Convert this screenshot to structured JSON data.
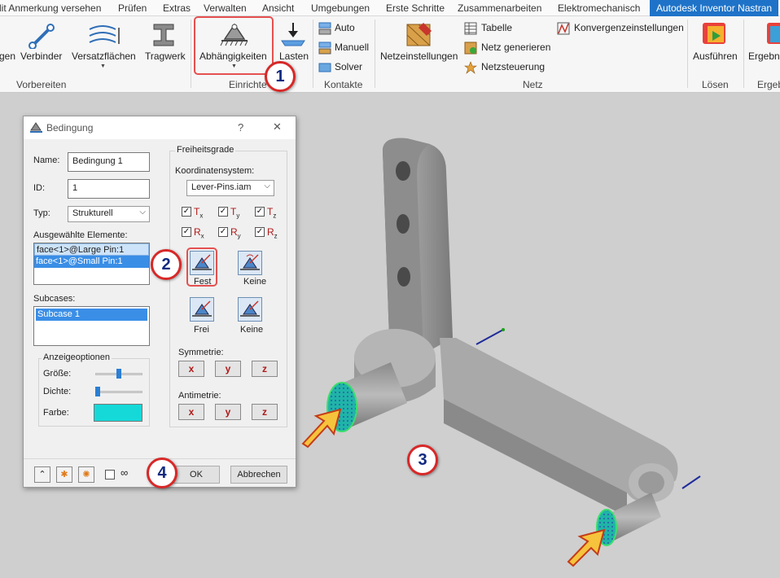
{
  "tabs": [
    "lit Anmerkung versehen",
    "Prüfen",
    "Extras",
    "Verwalten",
    "Ansicht",
    "Umgebungen",
    "Erste Schritte",
    "Zusammenarbeiten",
    "Elektromechanisch",
    "Autodesk Inventor Nastran"
  ],
  "ribbon": {
    "btn_gen": "gen",
    "btn_verbinder": "Verbinder",
    "btn_versatz": "Versatzflächen",
    "btn_tragwerk": "Tragwerk",
    "btn_abhaengig": "Abhängigkeiten",
    "btn_lasten": "Lasten",
    "btn_auto": "Auto",
    "btn_manuell": "Manuell",
    "btn_solver": "Solver",
    "btn_netzeinst": "Netzeinstellungen",
    "btn_tabelle": "Tabelle",
    "btn_netzgen": "Netz generieren",
    "btn_netzsteu": "Netzsteuerung",
    "btn_konvergenz": "Konvergenzeinstellungen",
    "btn_ausfuehren": "Ausführen",
    "btn_ergebnis": "Ergebnis",
    "grp_vorbereiten": "Vorbereiten",
    "grp_einrichten": "Einrichte",
    "grp_kontakte": "Kontakte",
    "grp_netz": "Netz",
    "grp_loesen": "Lösen",
    "grp_ergeb": "Ergeb"
  },
  "dialog": {
    "title": "Bedingung",
    "help": "?",
    "close": "✕",
    "name_label": "Name:",
    "name_value": "Bedingung 1",
    "id_label": "ID:",
    "id_value": "1",
    "typ_label": "Typ:",
    "typ_value": "Strukturell",
    "elements_label": "Ausgewählte Elemente:",
    "elements": [
      "face<1>@Large Pin:1",
      "face<1>@Small Pin:1"
    ],
    "subcases_label": "Subcases:",
    "subcases": [
      "Subcase 1"
    ],
    "display_label": "Anzeigeoptionen",
    "groesse": "Größe:",
    "dichte": "Dichte:",
    "farbe": "Farbe:",
    "farbe_color": "#15d9d9",
    "freiheitsgrade": "Freiheitsgrade",
    "koord_label": "Koordinatensystem:",
    "koord_value": "Lever-Pins.iam",
    "dof_t": "T",
    "dof_r": "R",
    "fest": "Fest",
    "keine": "Keine",
    "frei": "Frei",
    "keine2": "Keine",
    "symmetrie": "Symmetrie:",
    "antimetrie": "Antimetrie:",
    "ok": "OK",
    "abbrechen": "Abbrechen"
  },
  "callouts": [
    "1",
    "2",
    "3",
    "4"
  ]
}
